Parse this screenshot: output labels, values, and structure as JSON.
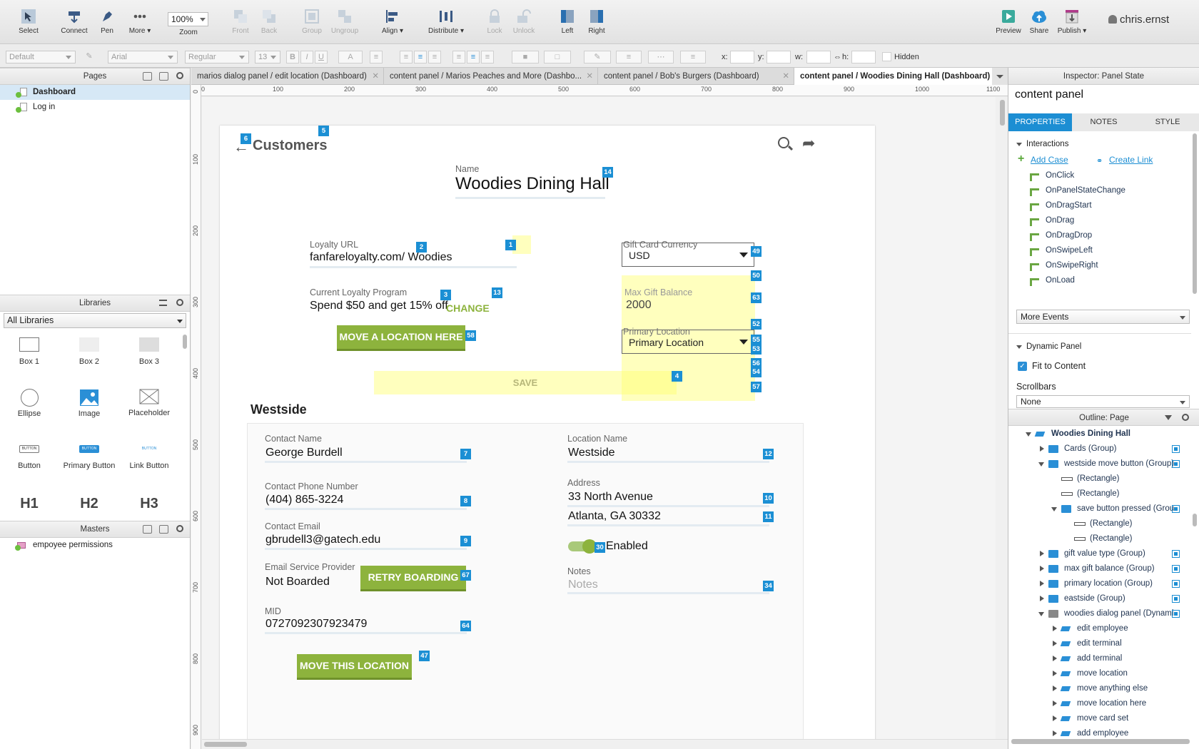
{
  "toolbar": {
    "select": "Select",
    "connect": "Connect",
    "pen": "Pen",
    "more": "More ▾",
    "zoom_value": "100%",
    "zoom": "Zoom",
    "front": "Front",
    "back": "Back",
    "group": "Group",
    "ungroup": "Ungroup",
    "align": "Align ▾",
    "distribute": "Distribute ▾",
    "lock": "Lock",
    "unlock": "Unlock",
    "left": "Left",
    "right": "Right",
    "preview": "Preview",
    "share": "Share",
    "publish": "Publish ▾",
    "user": "chris.ernst"
  },
  "format": {
    "style": "Default",
    "font": "Arial",
    "weight": "Regular",
    "size": "13",
    "x": "x:",
    "y": "y:",
    "w": "w:",
    "h": "h:",
    "hidden": "Hidden"
  },
  "pages": {
    "title": "Pages",
    "items": [
      "Dashboard",
      "Log in"
    ]
  },
  "libraries": {
    "title": "Libraries",
    "selected": "All Libraries",
    "items": [
      "Box 1",
      "Box 2",
      "Box 3",
      "Ellipse",
      "Image",
      "Placeholder",
      "Button",
      "Primary Button",
      "Link Button",
      "H1",
      "H2",
      "H3"
    ],
    "button_text": "BUTTON"
  },
  "masters": {
    "title": "Masters",
    "items": [
      "empoyee permissions"
    ]
  },
  "tabs": [
    "marios dialog panel / edit location (Dashboard)",
    "content panel / Marios Peaches and More (Dashbo...",
    "content panel / Bob's Burgers (Dashboard)",
    "content panel / Woodies Dining Hall (Dashboard)"
  ],
  "ruler_h": [
    "0",
    "100",
    "200",
    "300",
    "400",
    "500",
    "600",
    "700",
    "800",
    "900",
    "1000",
    "1100"
  ],
  "ruler_v": [
    "0",
    "100",
    "200",
    "300",
    "400",
    "500",
    "600",
    "700",
    "800",
    "900"
  ],
  "design": {
    "back_label": "Customers",
    "name_label": "Name",
    "name_value": "Woodies Dining Hall",
    "loyalty_url_label": "Loyalty URL",
    "loyalty_url_value": "fanfareloyalty.com/ Woodies",
    "program_label": "Current Loyalty Program",
    "program_value": "Spend $50 and get 15% off",
    "change": "CHANGE",
    "move_here": "MOVE A LOCATION HERE",
    "save": "SAVE",
    "gift_currency_label": "Gift Card Currency",
    "gift_currency_value": "USD",
    "max_gift_label": "Max Gift Balance",
    "max_gift_value": "2000",
    "primary_loc_label": "Primary Location",
    "primary_loc_value": "Primary Location",
    "section": "Westside",
    "contact_name_label": "Contact Name",
    "contact_name_value": "George Burdell",
    "phone_label": "Contact Phone Number",
    "phone_value": "(404) 865-3224",
    "email_label": "Contact Email",
    "email_value": "gbrudell3@gatech.edu",
    "esp_label": "Email Service Provider",
    "esp_value": "Not Boarded",
    "retry": "RETRY BOARDING",
    "mid_label": "MID",
    "mid_value": "0727092307923479",
    "move_this": "MOVE THIS LOCATION",
    "loc_name_label": "Location Name",
    "loc_name_value": "Westside",
    "address_label": "Address",
    "address_line1": "33 North Avenue",
    "address_line2": "Atlanta, GA 30332",
    "enabled": "Enabled",
    "notes_label": "Notes",
    "notes_placeholder": "Notes",
    "badges": [
      "6",
      "5",
      "14",
      "2",
      "1",
      "3",
      "13",
      "58",
      "49",
      "50",
      "63",
      "52",
      "55",
      "53",
      "56",
      "54",
      "57",
      "4",
      "7",
      "8",
      "9",
      "67",
      "64",
      "47",
      "12",
      "10",
      "11",
      "30",
      "34"
    ]
  },
  "inspector": {
    "title": "Inspector: Panel State",
    "name": "content panel",
    "tab_properties": "PROPERTIES",
    "tab_notes": "NOTES",
    "tab_style": "STYLE",
    "interactions": "Interactions",
    "add_case": "Add Case",
    "create_link": "Create Link",
    "events": [
      "OnClick",
      "OnPanelStateChange",
      "OnDragStart",
      "OnDrag",
      "OnDragDrop",
      "OnSwipeLeft",
      "OnSwipeRight",
      "OnLoad"
    ],
    "more_events": "More Events",
    "dynamic_panel": "Dynamic Panel",
    "fit_to_content": "Fit to Content",
    "scrollbars": "Scrollbars",
    "scrollbars_value": "None"
  },
  "outline": {
    "title": "Outline: Page",
    "items": [
      "Woodies Dining Hall",
      "Cards (Group)",
      "westside move button (Group)",
      "(Rectangle)",
      "(Rectangle)",
      "save button pressed (Grou",
      "(Rectangle)",
      "(Rectangle)",
      "gift value type (Group)",
      "max gift balance (Group)",
      "primary location (Group)",
      "eastside (Group)",
      "woodies dialog panel (Dynami",
      "edit employee",
      "edit terminal",
      "add terminal",
      "move location",
      "move anything else",
      "move location here",
      "move card set",
      "add employee"
    ]
  },
  "colors": {
    "accent": "#1c8ed3",
    "button_green": "#8db33d",
    "highlight_yellow": "#ffff6e"
  }
}
